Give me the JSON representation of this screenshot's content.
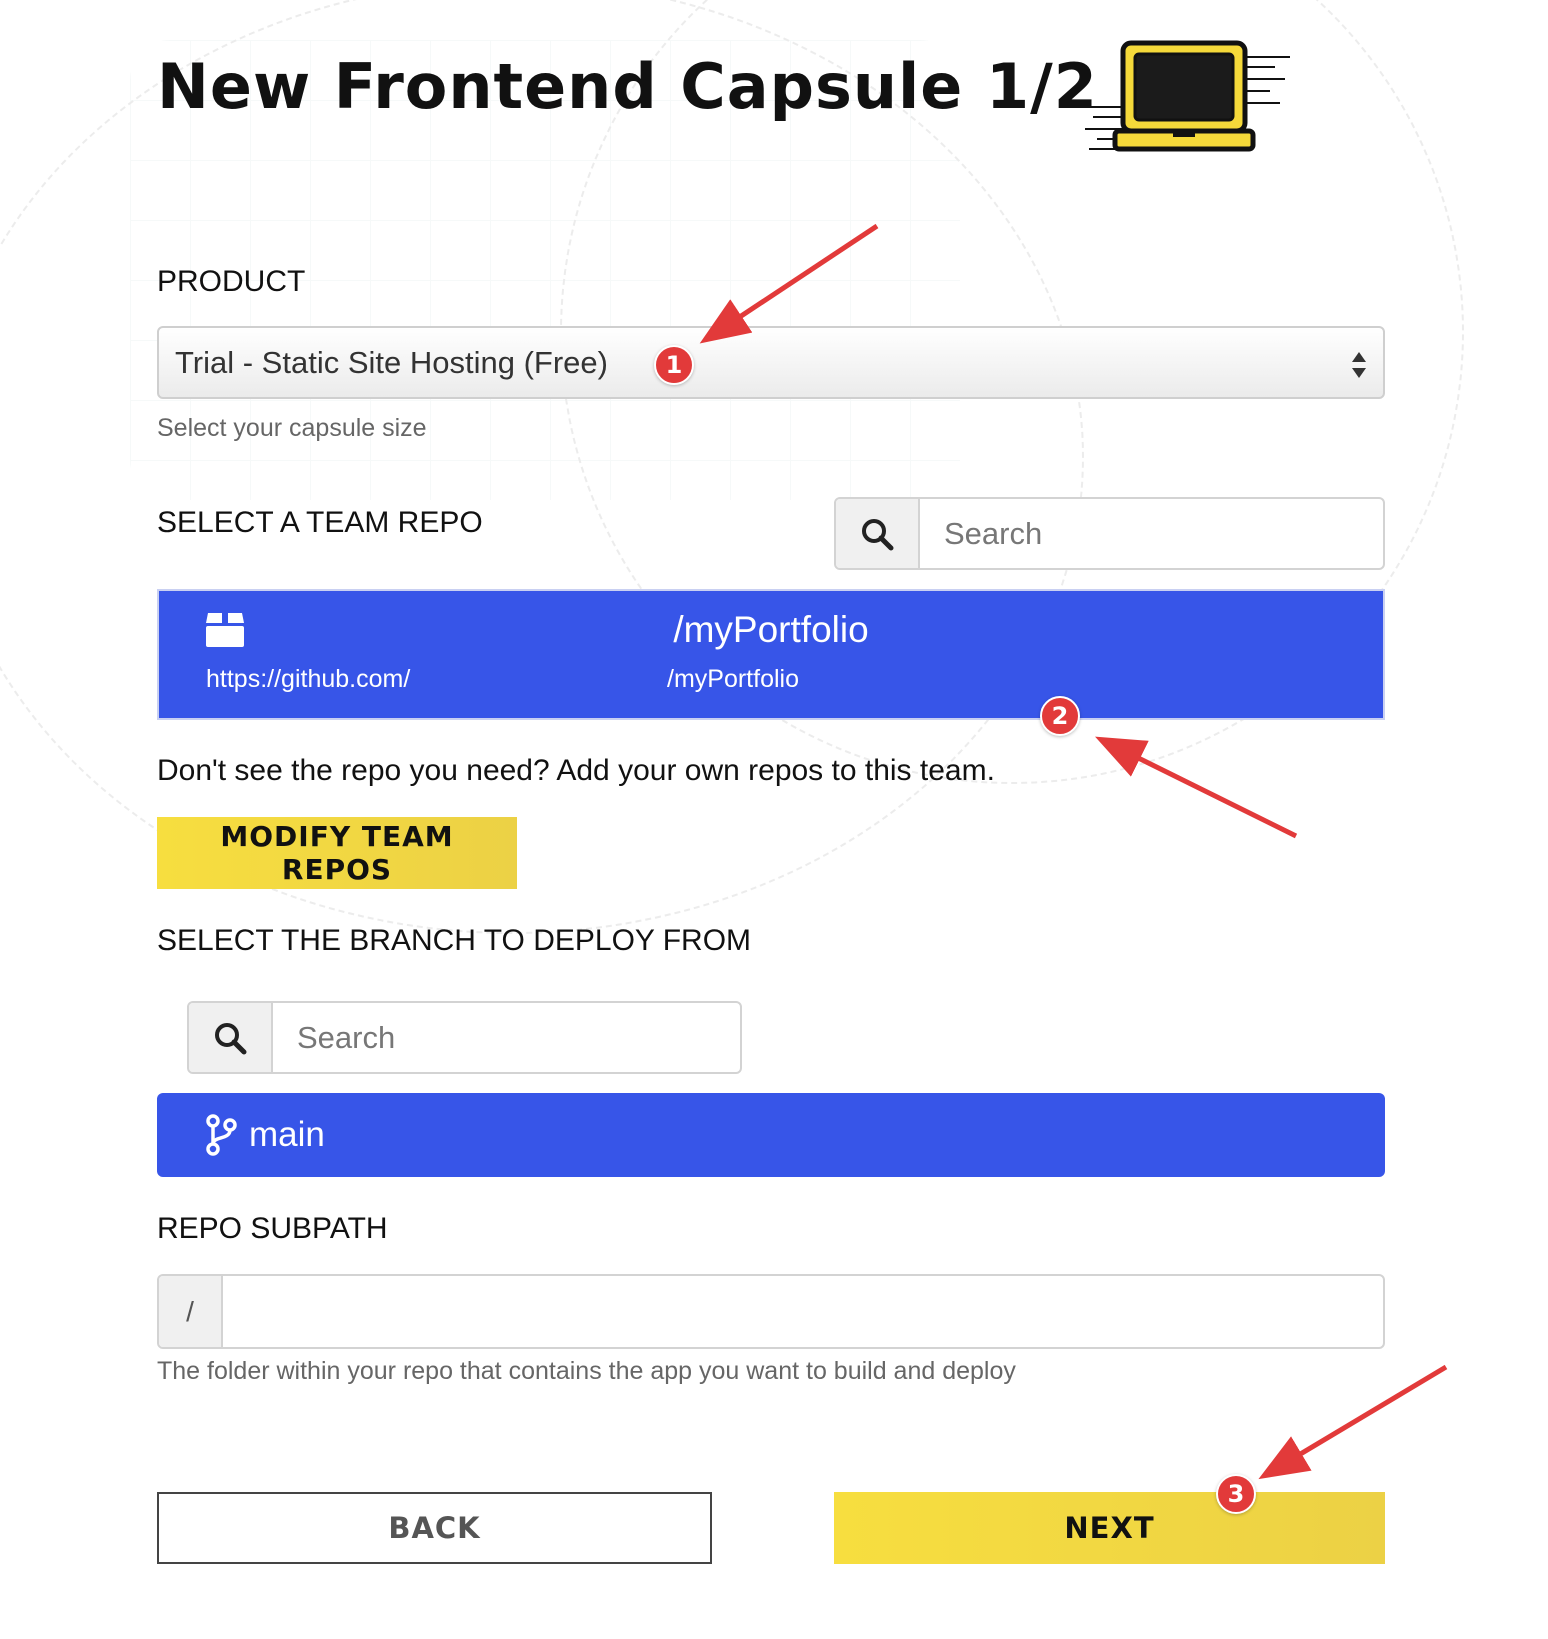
{
  "page": {
    "title": "New Frontend Capsule 1/2"
  },
  "product": {
    "label": "PRODUCT",
    "selected": "Trial - Static Site Hosting (Free)",
    "help": "Select your capsule size"
  },
  "team_repo": {
    "label": "SELECT A TEAM REPO",
    "search_placeholder": "Search",
    "selected_repo": {
      "name": "/myPortfolio",
      "url": "https://github.com/",
      "path": "/myPortfolio"
    },
    "hint": "Don't see the repo you need? Add your own repos to this team.",
    "modify_button": "MODIFY TEAM REPOS"
  },
  "branch": {
    "label": "SELECT THE BRANCH TO DEPLOY FROM",
    "search_placeholder": "Search",
    "selected": "main"
  },
  "subpath": {
    "label": "REPO SUBPATH",
    "prefix": "/",
    "value": "",
    "help": "The folder within your repo that contains the app you want to build and deploy"
  },
  "actions": {
    "back": "BACK",
    "next": "NEXT"
  },
  "annotations": {
    "markers": [
      "1",
      "2",
      "3"
    ],
    "color": "#e23a3a"
  },
  "colors": {
    "accent_blue": "#3755e8",
    "accent_yellow": "#f7de3f"
  }
}
